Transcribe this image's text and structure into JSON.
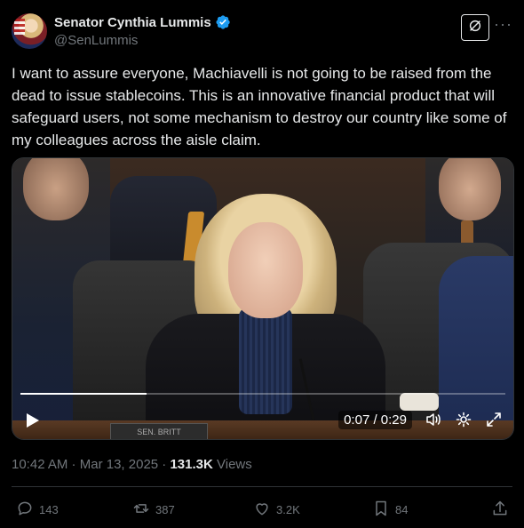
{
  "author": {
    "display_name": "Senator Cynthia Lummis",
    "handle": "@SenLummis",
    "verified_icon": "verified-badge-icon",
    "verified_color": "#1d9bf0"
  },
  "header_icons": {
    "grok": "grok-icon",
    "more": "···"
  },
  "tweet": {
    "text": "I want to assure everyone, Machiavelli is not going to be raised from the dead to issue stablecoins. This is an innovative financial product that will safeguard users, not some mechanism to destroy our country like some of my colleagues across the aisle claim."
  },
  "video": {
    "time_display": "0:07 / 0:29",
    "progress": 0.26,
    "nameplate_text": "SEN. BRITT",
    "controls": [
      "play-icon",
      "volume-icon",
      "settings-icon",
      "fullscreen-icon"
    ]
  },
  "meta": {
    "time": "10:42 AM",
    "separator": " · ",
    "date": "Mar 13, 2025",
    "separator2": " · ",
    "views_count": "131.3K",
    "views_label": " Views"
  },
  "actions": {
    "replies": "143",
    "reposts": "387",
    "likes": "3.2K",
    "bookmarks": "84"
  },
  "colors": {
    "background": "#000000",
    "text": "#e7e9ea",
    "secondary": "#71767b",
    "border": "#2f3336",
    "accent": "#1d9bf0"
  }
}
